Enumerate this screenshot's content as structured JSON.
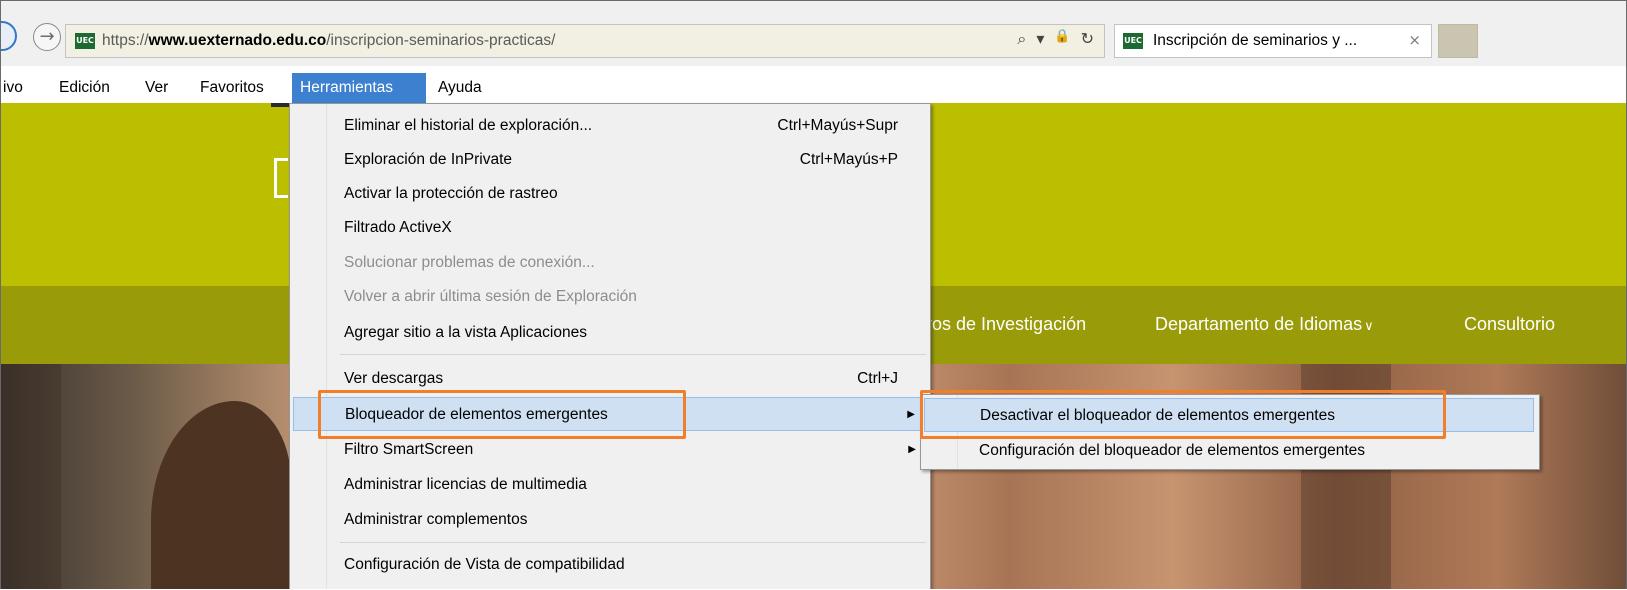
{
  "browser": {
    "url": {
      "scheme": "https://",
      "domain": "www.uexternado.edu.co",
      "path": "/inscripcion-seminarios-practicas/"
    },
    "favicon_text": "UEC",
    "tab_title": "Inscripción de seminarios y ...",
    "tab_close": "×",
    "forward_glyph": "→",
    "tools": {
      "search": "⌕",
      "dropdown": "▾",
      "lock": "🔒",
      "refresh": "↻"
    }
  },
  "menubar": {
    "items": [
      "ivo",
      "Edición",
      "Ver",
      "Favoritos",
      "Herramientas",
      "Ayuda"
    ],
    "active": "Herramientas"
  },
  "page": {
    "nav": [
      "tros de Investigación",
      "Departamento de Idiomas",
      "Consultorio"
    ],
    "chevron": "∨",
    "header_color": "#bcbe00",
    "nav_color": "#9a9b09"
  },
  "tools_menu": {
    "items": [
      {
        "label": "Eliminar el historial de exploración...",
        "shortcut": "Ctrl+Mayús+Supr"
      },
      {
        "label": "Exploración de InPrivate",
        "shortcut": "Ctrl+Mayús+P"
      },
      {
        "label": "Activar la protección de rastreo"
      },
      {
        "label": "Filtrado ActiveX"
      },
      {
        "label": "Solucionar problemas de conexión...",
        "disabled": true
      },
      {
        "label": "Volver a abrir última sesión de Exploración",
        "disabled": true
      },
      {
        "label": "Agregar sitio a la vista Aplicaciones"
      },
      {
        "label": "Ver descargas",
        "shortcut": "Ctrl+J"
      },
      {
        "label": "Bloqueador de elementos emergentes",
        "submenu": true,
        "highlighted": true
      },
      {
        "label": "Filtro SmartScreen",
        "submenu": true
      },
      {
        "label": "Administrar licencias de multimedia"
      },
      {
        "label": "Administrar complementos"
      },
      {
        "label": "Configuración de Vista de compatibilidad"
      }
    ],
    "submenu_arrow": "▶"
  },
  "popup_submenu": {
    "items": [
      {
        "label": "Desactivar el bloqueador de elementos emergentes",
        "highlighted": true
      },
      {
        "label": "Configuración del bloqueador de elementos emergentes"
      }
    ]
  },
  "colors": {
    "highlight_box": "#ef7f2b",
    "menubar_active": "#3c80cf",
    "menu_hover": "#cfe0f3"
  }
}
